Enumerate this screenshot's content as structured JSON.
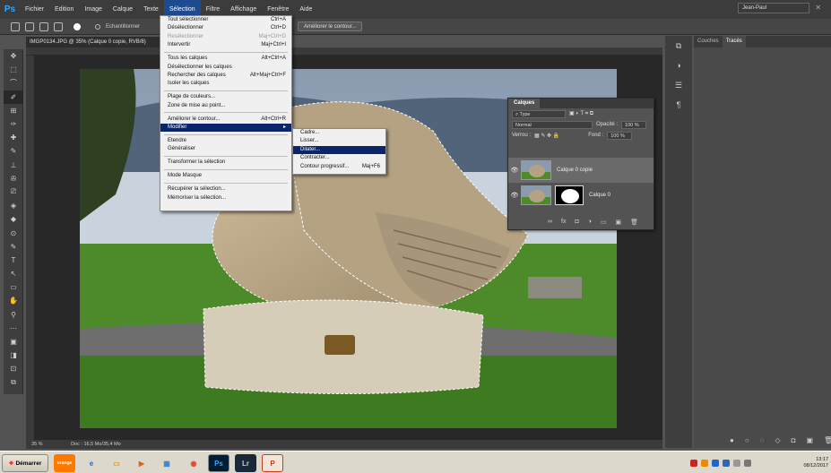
{
  "app": {
    "logo": "Ps"
  },
  "menubar": [
    "Fichier",
    "Edition",
    "Image",
    "Calque",
    "Texte",
    "Sélection",
    "Filtre",
    "Affichage",
    "Fenêtre",
    "Aide"
  ],
  "menubar_active": "Sélection",
  "options_bar": {
    "sample_label": "Echantillonner",
    "refine_button": "Améliorer le contour...",
    "workspace": "Jean-Paul"
  },
  "document": {
    "tab_title": "IMGP0134.JPG @ 35% (Calque 0 copie, RVB/8)",
    "status_zoom": "35 %",
    "status_doc": "Doc : 16,5 Mo/35,4 Mo"
  },
  "selection_menu": [
    {
      "label": "Tout sélectionner",
      "shortcut": "Ctrl+A"
    },
    {
      "label": "Désélectionner",
      "shortcut": "Ctrl+D"
    },
    {
      "label": "Resélectionner",
      "shortcut": "Maj+Ctrl+D",
      "disabled": true
    },
    {
      "label": "Intervertir",
      "shortcut": "Maj+Ctrl+I"
    },
    {
      "sep": true
    },
    {
      "label": "Tous les calques",
      "shortcut": "Alt+Ctrl+A"
    },
    {
      "label": "Désélectionner les calques",
      "shortcut": ""
    },
    {
      "label": "Rechercher des calques",
      "shortcut": "Alt+Maj+Ctrl+F"
    },
    {
      "label": "Isoler les calques",
      "shortcut": ""
    },
    {
      "sep": true
    },
    {
      "label": "Plage de couleurs...",
      "shortcut": ""
    },
    {
      "label": "Zone de mise au point...",
      "shortcut": ""
    },
    {
      "sep": true
    },
    {
      "label": "Améliorer le contour...",
      "shortcut": "Alt+Ctrl+R"
    },
    {
      "label": "Modifier",
      "shortcut": "",
      "submenu": true,
      "highlighted": true
    },
    {
      "sep": true
    },
    {
      "label": "Etendre",
      "shortcut": ""
    },
    {
      "label": "Généraliser",
      "shortcut": ""
    },
    {
      "sep": true
    },
    {
      "label": "Transformer la sélection",
      "shortcut": ""
    },
    {
      "sep": true
    },
    {
      "label": "Mode Masque",
      "shortcut": ""
    },
    {
      "sep": true
    },
    {
      "label": "Récupérer la sélection...",
      "shortcut": ""
    },
    {
      "label": "Mémoriser la sélection...",
      "shortcut": ""
    }
  ],
  "modify_submenu": [
    {
      "label": "Cadre...",
      "shortcut": ""
    },
    {
      "label": "Lisser...",
      "shortcut": ""
    },
    {
      "label": "Dilater...",
      "shortcut": "",
      "highlighted": true
    },
    {
      "label": "Contracter...",
      "shortcut": ""
    },
    {
      "label": "Contour progressif...",
      "shortcut": "Maj+F6"
    }
  ],
  "layers_panel": {
    "tab": "Calques",
    "filter": "Type",
    "blend_mode": "Normal",
    "opacity_label": "Opacité :",
    "opacity": "100 %",
    "lock_label": "Verrou :",
    "fill_label": "Fond :",
    "fill": "100 %",
    "layers": [
      {
        "name": "Calque 0 copie",
        "selected": true
      },
      {
        "name": "Calque 0",
        "selected": false
      }
    ]
  },
  "paths_panel": {
    "tabs": [
      "Couches",
      "Tracés"
    ],
    "active_tab": "Tracés"
  },
  "taskbar": {
    "start": "Démarrer",
    "apps": [
      "orange",
      "ie",
      "explorer",
      "media",
      "photos",
      "chrome",
      "Ps",
      "Lr",
      "ppt"
    ],
    "time": "13:17",
    "date": "08/12/2017"
  },
  "colors": {
    "menu_highlight": "#0b256a",
    "menubar_active": "#1d4b8f",
    "ps_blue": "#31a8ff"
  }
}
